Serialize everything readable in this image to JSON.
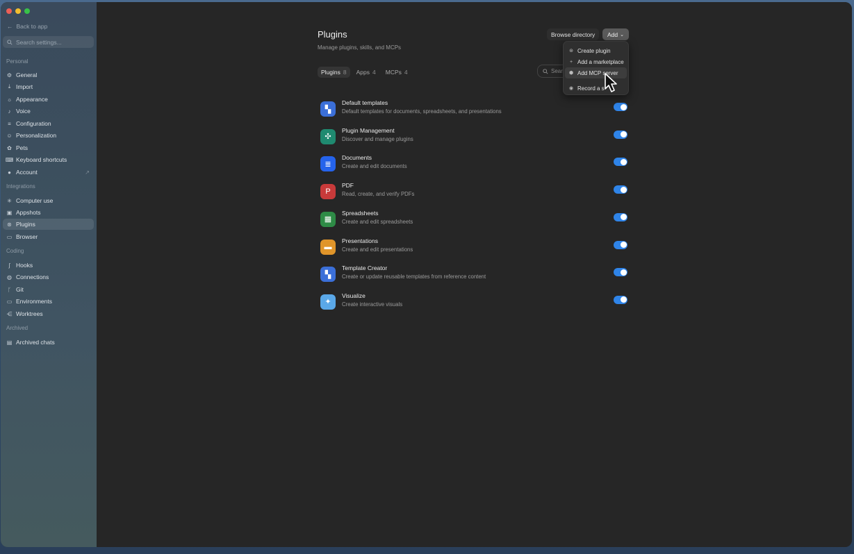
{
  "sidebar": {
    "back": "Back to app",
    "search_placeholder": "Search settings...",
    "sections": [
      {
        "title": "Personal",
        "items": [
          {
            "label": "General",
            "icon": "gear-icon"
          },
          {
            "label": "Import",
            "icon": "download-icon"
          },
          {
            "label": "Appearance",
            "icon": "sun-icon"
          },
          {
            "label": "Voice",
            "icon": "mic-icon"
          },
          {
            "label": "Configuration",
            "icon": "sliders-icon"
          },
          {
            "label": "Personalization",
            "icon": "smile-icon"
          },
          {
            "label": "Pets",
            "icon": "paw-icon"
          },
          {
            "label": "Keyboard shortcuts",
            "icon": "keyboard-icon"
          },
          {
            "label": "Account",
            "icon": "user-icon"
          }
        ]
      },
      {
        "title": "Integrations",
        "items": [
          {
            "label": "Computer use",
            "icon": "sparkle-icon"
          },
          {
            "label": "Appshots",
            "icon": "camera-icon"
          },
          {
            "label": "Plugins",
            "icon": "plugin-icon"
          },
          {
            "label": "Browser",
            "icon": "browser-icon"
          }
        ]
      },
      {
        "title": "Coding",
        "items": [
          {
            "label": "Hooks",
            "icon": "hook-icon"
          },
          {
            "label": "Connections",
            "icon": "globe-icon"
          },
          {
            "label": "Git",
            "icon": "branch-icon"
          },
          {
            "label": "Environments",
            "icon": "monitor-icon"
          },
          {
            "label": "Worktrees",
            "icon": "tree-icon"
          }
        ]
      },
      {
        "title": "Archived",
        "items": [
          {
            "label": "Archived chats",
            "icon": "archive-icon"
          }
        ]
      }
    ]
  },
  "header": {
    "title": "Plugins",
    "subtitle": "Manage plugins, skills, and MCPs",
    "browse_label": "Browse directory",
    "add_label": "Add"
  },
  "tabs": [
    {
      "label": "Plugins",
      "count": "8"
    },
    {
      "label": "Apps",
      "count": "4"
    },
    {
      "label": "MCPs",
      "count": "4"
    }
  ],
  "search": {
    "placeholder": "Sear"
  },
  "plugins": [
    {
      "name": "Default templates",
      "desc": "Default templates for documents, spreadsheets, and presentations",
      "color": "#3b6fd8",
      "icon": "templates-icon",
      "enabled": true
    },
    {
      "name": "Plugin Management",
      "desc": "Discover and manage plugins",
      "color": "#1f8a70",
      "icon": "plugin-manage-icon",
      "enabled": true
    },
    {
      "name": "Documents",
      "desc": "Create and edit documents",
      "color": "#2563eb",
      "icon": "document-icon",
      "enabled": true
    },
    {
      "name": "PDF",
      "desc": "Read, create, and verify PDFs",
      "color": "#c83a3a",
      "icon": "pdf-icon",
      "enabled": true
    },
    {
      "name": "Spreadsheets",
      "desc": "Create and edit spreadsheets",
      "color": "#2e8b46",
      "icon": "spreadsheet-icon",
      "enabled": true
    },
    {
      "name": "Presentations",
      "desc": "Create and edit presentations",
      "color": "#e0952a",
      "icon": "presentation-icon",
      "enabled": true
    },
    {
      "name": "Template Creator",
      "desc": "Create or update reusable templates from reference content",
      "color": "#3b6fd8",
      "icon": "template-creator-icon",
      "enabled": true
    },
    {
      "name": "Visualize",
      "desc": "Create interactive visuals",
      "color": "#5aa8e8",
      "icon": "visualize-icon",
      "enabled": true
    }
  ],
  "add_menu": [
    {
      "label": "Create plugin",
      "icon": "plugin-icon"
    },
    {
      "label": "Add a marketplace",
      "icon": "plus-icon"
    },
    {
      "label": "Add MCP server",
      "icon": "server-icon"
    },
    {
      "label": "Record a s",
      "icon": "record-icon"
    }
  ]
}
